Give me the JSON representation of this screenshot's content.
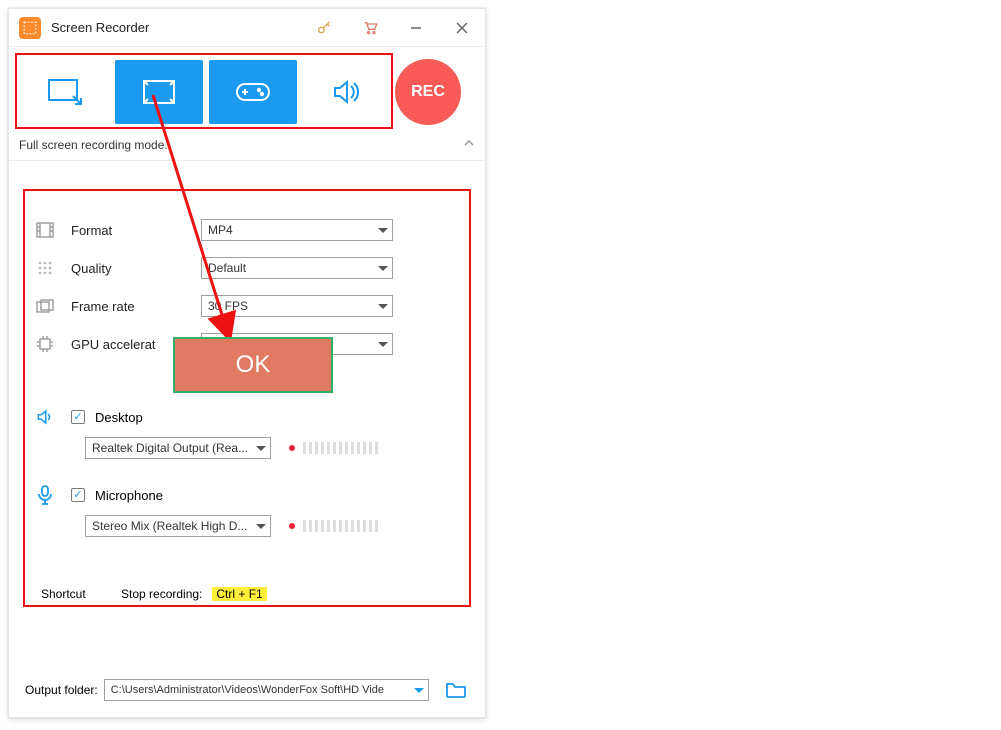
{
  "titlebar": {
    "app_name": "Screen Recorder"
  },
  "modes": {
    "hint": "Full screen recording mode.",
    "rec_label": "REC"
  },
  "settings": {
    "format": {
      "label": "Format",
      "value": "MP4"
    },
    "quality": {
      "label": "Quality",
      "value": "Default"
    },
    "framerate": {
      "label": "Frame rate",
      "value": "30 FPS"
    },
    "gpu": {
      "label": "GPU accelerat",
      "value": ""
    }
  },
  "audio": {
    "desktop": {
      "label": "Desktop",
      "checked": true,
      "device": "Realtek Digital Output (Rea..."
    },
    "mic": {
      "label": "Microphone",
      "checked": true,
      "device": "Stereo Mix (Realtek High D..."
    }
  },
  "shortcut": {
    "group_label": "Shortcut",
    "action_label": "Stop recording:",
    "hotkey": "Ctrl + F1"
  },
  "output": {
    "label": "Output folder:",
    "path": "C:\\Users\\Administrator\\Videos\\WonderFox Soft\\HD Vide"
  },
  "callout": {
    "ok": "OK"
  }
}
